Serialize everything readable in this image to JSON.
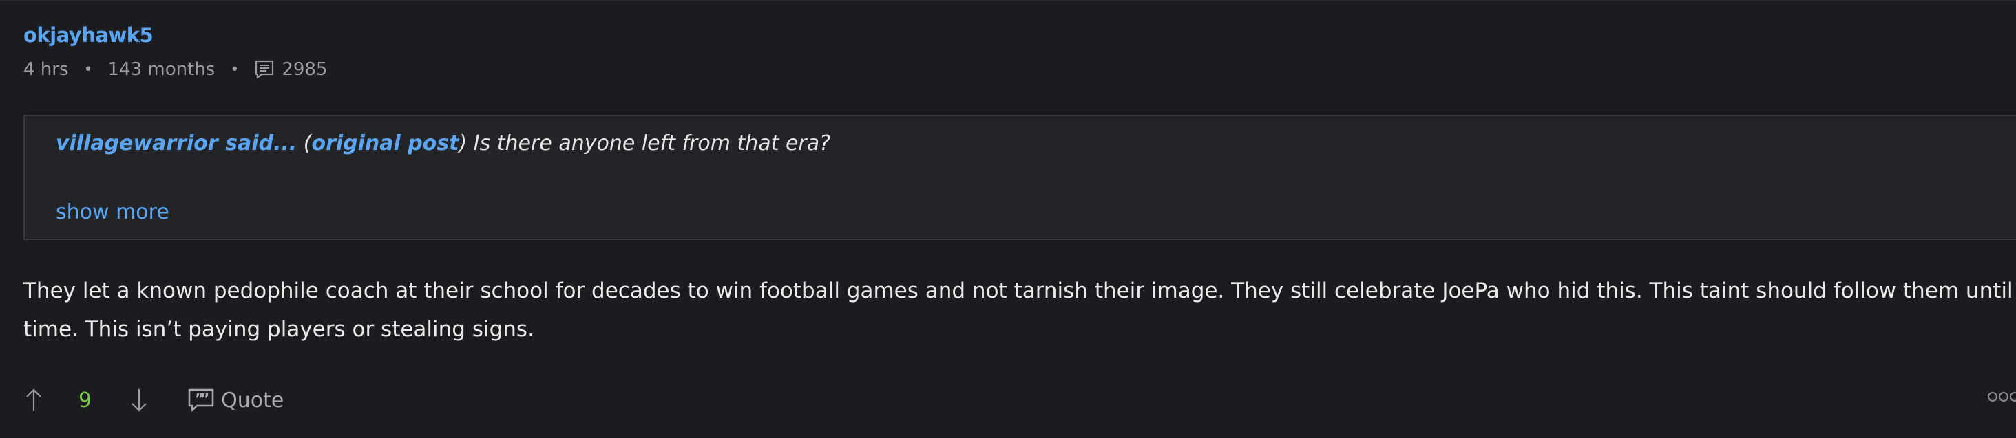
{
  "post": {
    "username": "okjayhawk5",
    "meta": {
      "time_ago": "4 hrs",
      "tenure": "143 months",
      "post_count": "2985",
      "separator": "•"
    },
    "quote": {
      "author": "villagewarrior said...",
      "open_paren": " (",
      "link_label": "original post",
      "close_paren_text": ") Is there anyone left from that era?",
      "show_more_label": "show more"
    },
    "body_lines": [
      "They let a known pedophile coach at their school for decades to win football games and not tarnish their image. They still celebrate JoePa who hid this. This taint should follow them until the end of",
      "time. This isn’t paying players or stealing signs."
    ],
    "actions": {
      "vote_count": "9",
      "quote_label": "Quote"
    }
  },
  "colors": {
    "background": "#1b1c1f",
    "link": "#5aa6f2",
    "vote_positive": "#7ac943",
    "quote_bg": "#232427"
  },
  "icons": [
    "comment-icon",
    "upvote-arrow-icon",
    "downvote-arrow-icon",
    "quote-bubble-icon",
    "more-options-icon"
  ]
}
